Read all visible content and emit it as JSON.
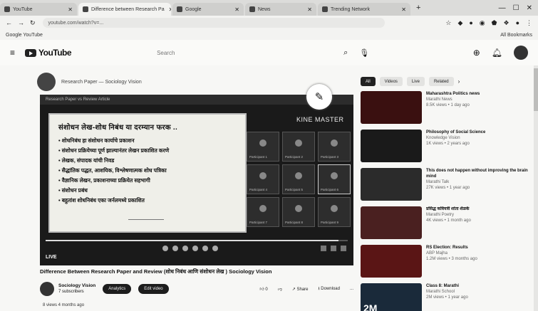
{
  "browser": {
    "tabs": [
      {
        "title": "YouTube"
      },
      {
        "title": "Difference between Research Pa"
      },
      {
        "title": "Google"
      },
      {
        "title": "News"
      },
      {
        "title": "Trending Network"
      }
    ],
    "new_tab": "+",
    "address": "youtube.com/watch?v=...",
    "bookmarks_left": "Google  YouTube",
    "bookmarks_right": "All Bookmarks"
  },
  "youtube": {
    "logo": "YouTube",
    "search_placeholder": "Search"
  },
  "channel_strip": {
    "text": "Research Paper — Sociology Vision"
  },
  "video": {
    "top_bar": "Research Paper vs Review Article",
    "slide_title": "संशोधन लेख-शोध निबंध या दरम्यान फरक ..",
    "slide_points": [
      "• शोधनिबंध हा संशोधन कार्याचे प्रकाशन",
      "• संशोधन प्रक्रियेच्या पूर्ण झाल्यानंतर लेखन प्रकाशित करणे",
      "• लेखक, संपादक यांची निवड",
      "• सैद्धांतिक पद्धत, आशयिक, विश्लेषणात्मक शोध पत्रिका",
      "• वैज्ञानिक लेखन, प्रकाशनाच्या प्रक्रियेत सहभागी",
      "• संशोधन प्रबंध",
      "• बहुतांश शोधनिबंध एका जर्नलमध्ये प्रकाशित"
    ],
    "watermark": "KINE MASTER",
    "participants": [
      "Participant 1",
      "Participant 2",
      "Participant 3",
      "Participant 4",
      "Participant 5",
      "Participant 6",
      "Participant 7",
      "Participant 8",
      "Participant 9"
    ],
    "progress": 0.97,
    "live_label": "LIVE"
  },
  "title": "Difference Between Research Paper and Review (शोध निबंध आणि संशोधन लेख ) Sociology Vision",
  "channel": {
    "name": "Sociology Vision",
    "subs": "7 subscribers"
  },
  "actions": {
    "analytics": "Analytics",
    "edit": "Edit video",
    "likes": "0",
    "share": "Share",
    "download": "Download",
    "more": "..."
  },
  "description_preview": "8 views  4 months ago",
  "sidebar": {
    "chips": [
      "All",
      "Videos",
      "Live",
      "Related"
    ],
    "recommendations": [
      {
        "title": "Maharashtra Politics news",
        "channel": "Marathi News",
        "meta": "8.5K views • 1 day ago",
        "thumb_color": "#3a1010",
        "caption": ""
      },
      {
        "title": "Philosophy of Social Science",
        "channel": "Knowledge Vision",
        "meta": "1K views • 2 years ago",
        "thumb_color": "#1a1a1a",
        "caption": ""
      },
      {
        "title": "This does not happen without improving the brain mind",
        "channel": "Marathi Talk",
        "meta": "27K views • 1 year ago",
        "thumb_color": "#2b2b2b",
        "caption": ""
      },
      {
        "title": "प्रसिद्ध कवियत्री शांता शेळके",
        "channel": "Marathi Poetry",
        "meta": "4K views • 1 month ago",
        "thumb_color": "#4a2020",
        "caption": ""
      },
      {
        "title": "RS Election: Results",
        "channel": "ABP Majha",
        "meta": "1.2M views • 3 months ago",
        "thumb_color": "#5a1515",
        "caption": ""
      },
      {
        "title": "Class 8: Marathi",
        "channel": "Marathi School",
        "meta": "2M views • 1 year ago",
        "thumb_color": "#1a2a3a",
        "caption": "2M"
      }
    ]
  }
}
